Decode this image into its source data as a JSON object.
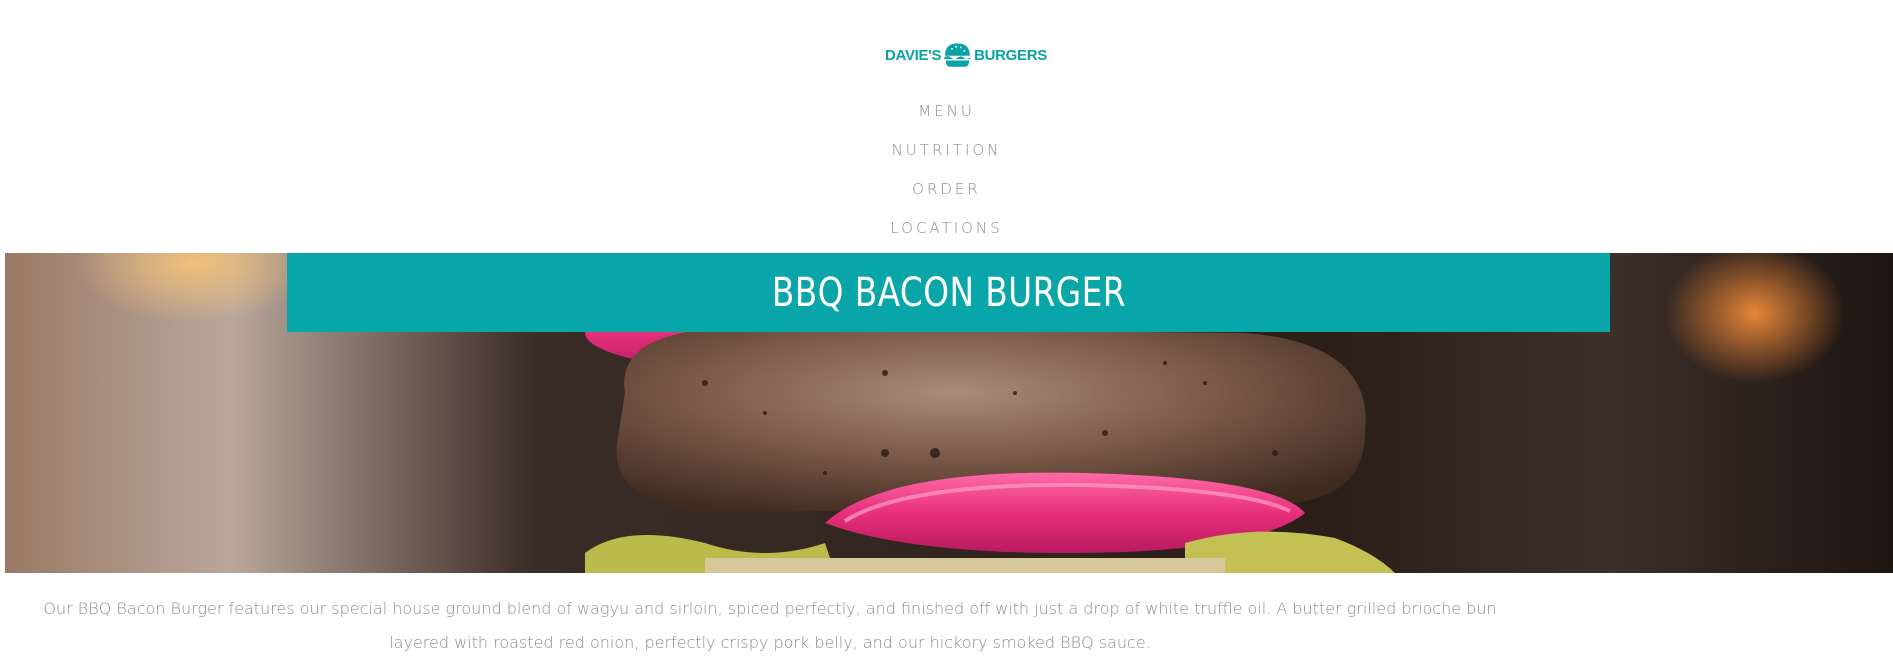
{
  "brand": {
    "left_word": "DAVIE'S",
    "right_word": "BURGERS",
    "accent_color": "#0aa2a6",
    "icon": "burger-bun-icon"
  },
  "nav": {
    "items": [
      {
        "label": "MENU"
      },
      {
        "label": "NUTRITION"
      },
      {
        "label": "ORDER"
      },
      {
        "label": "LOCATIONS"
      }
    ]
  },
  "hero": {
    "title": "BBQ BACON BURGER",
    "banner_color": "#08a6a8"
  },
  "description": "Our BBQ Bacon Burger features our special house ground blend of wagyu and sirloin, spiced perfectly, and finished off with just a drop of white truffle oil. A butter grilled brioche bun layered with roasted red onion, perfectly crispy pork belly, and our hickory smoked BBQ sauce."
}
